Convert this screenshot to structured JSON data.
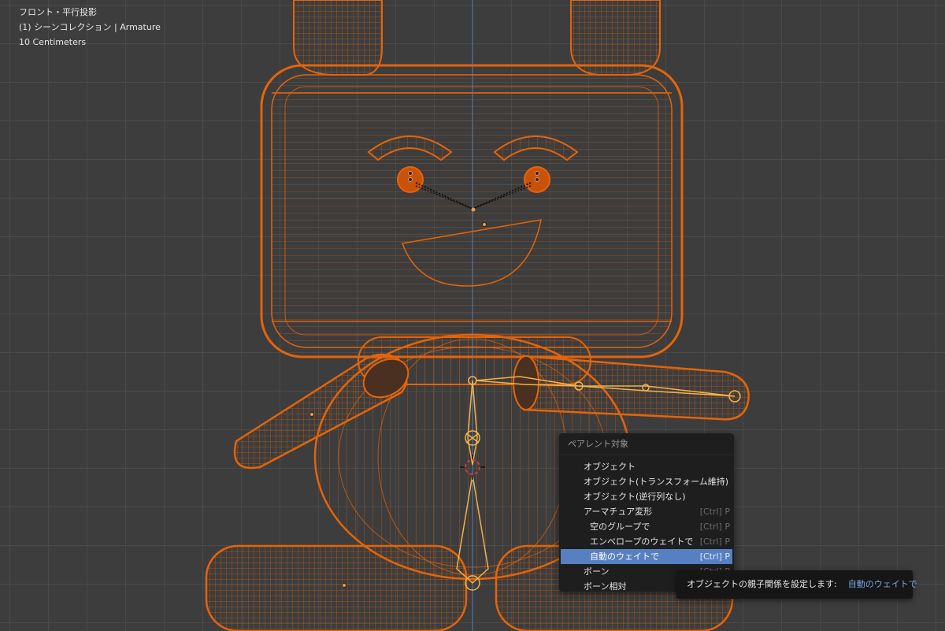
{
  "viewport": {
    "view_name": "フロント・平行投影",
    "collection": "(1) シーンコレクション | Armature",
    "scale": "10 Centimeters",
    "colors": {
      "background": "#3d3d3d",
      "grid": "#4a4a4a",
      "wire": "#e5640a",
      "bone": "#f0b24a",
      "axis": "#4a79b8"
    }
  },
  "menu": {
    "title": "ペアレント対象",
    "items": [
      {
        "label": "オブジェクト",
        "shortcut": ""
      },
      {
        "label": "オブジェクト(トランスフォーム維持)",
        "shortcut": ""
      },
      {
        "label": "オブジェクト(逆行列なし)",
        "shortcut": ""
      },
      {
        "label": "アーマチュア変形",
        "shortcut": "[Ctrl] P"
      },
      {
        "label": "空のグループで",
        "shortcut": "[Ctrl] P"
      },
      {
        "label": "エンベロープのウェイトで",
        "shortcut": "[Ctrl] P"
      },
      {
        "label": "自動のウェイトで",
        "shortcut": "[Ctrl] P"
      },
      {
        "label": "ボーン",
        "shortcut": "[Ctrl] P"
      },
      {
        "label": "ボーン相対",
        "shortcut": ""
      }
    ]
  },
  "tooltip": {
    "text": "オブジェクトの親子関係を設定します:",
    "value": "自動のウェイトで"
  }
}
